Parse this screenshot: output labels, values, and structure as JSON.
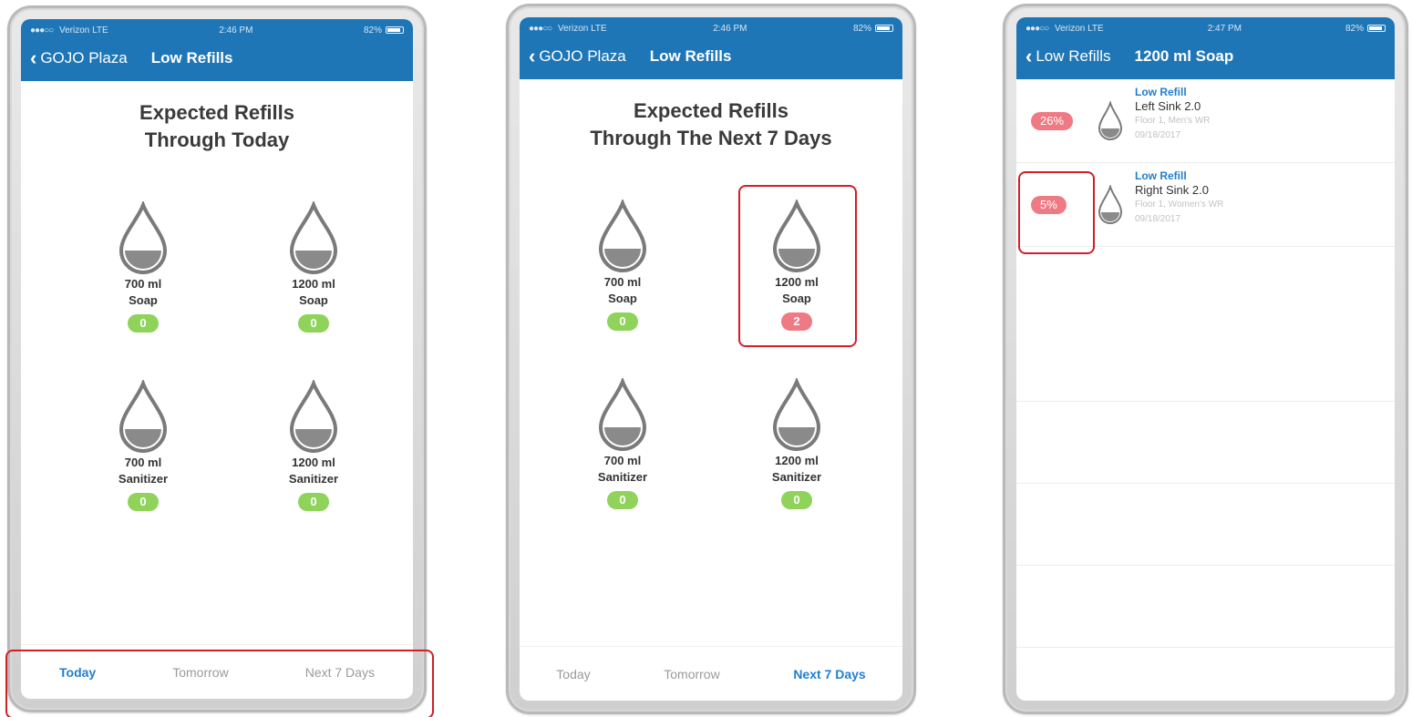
{
  "colors": {
    "nav": "#1f76b6",
    "active_tab": "#1f7fd0",
    "green_badge": "#8fd35a",
    "red_badge": "#ef7a84",
    "highlight": "#d11f2a"
  },
  "phones": [
    {
      "status": {
        "carrier": "Verizon  LTE",
        "time": "2:46 PM",
        "battery": "82%"
      },
      "nav": {
        "back": "GOJO Plaza",
        "title": "Low Refills"
      },
      "heading": [
        "Expected Refills",
        "Through Today"
      ],
      "items": [
        {
          "size": "700 ml",
          "type": "Soap",
          "count": "0",
          "status": "green"
        },
        {
          "size": "1200 ml",
          "type": "Soap",
          "count": "0",
          "status": "green"
        },
        {
          "size": "700 ml",
          "type": "Sanitizer",
          "count": "0",
          "status": "green"
        },
        {
          "size": "1200 ml",
          "type": "Sanitizer",
          "count": "0",
          "status": "green"
        }
      ],
      "tabs": [
        "Today",
        "Tomorrow",
        "Next 7 Days"
      ],
      "active_tab": 0
    },
    {
      "status": {
        "carrier": "Verizon  LTE",
        "time": "2:46 PM",
        "battery": "82%"
      },
      "nav": {
        "back": "GOJO Plaza",
        "title": "Low Refills"
      },
      "heading": [
        "Expected Refills",
        "Through The Next 7 Days"
      ],
      "items": [
        {
          "size": "700 ml",
          "type": "Soap",
          "count": "0",
          "status": "green"
        },
        {
          "size": "1200 ml",
          "type": "Soap",
          "count": "2",
          "status": "red"
        },
        {
          "size": "700 ml",
          "type": "Sanitizer",
          "count": "0",
          "status": "green"
        },
        {
          "size": "1200 ml",
          "type": "Sanitizer",
          "count": "0",
          "status": "green"
        }
      ],
      "tabs": [
        "Today",
        "Tomorrow",
        "Next 7 Days"
      ],
      "active_tab": 2
    },
    {
      "status": {
        "carrier": "Verizon  LTE",
        "time": "2:47 PM",
        "battery": "82%"
      },
      "nav": {
        "back": "Low Refills",
        "title": "1200 ml Soap"
      },
      "rows": [
        {
          "percent": "26%",
          "kind": "Low Refill",
          "name": "Left Sink 2.0",
          "location": "Floor 1, Men's WR",
          "date": "09/18/2017"
        },
        {
          "percent": "5%",
          "kind": "Low Refill",
          "name": "Right Sink 2.0",
          "location": "Floor 1, Women's WR",
          "date": "09/18/2017"
        }
      ]
    }
  ]
}
